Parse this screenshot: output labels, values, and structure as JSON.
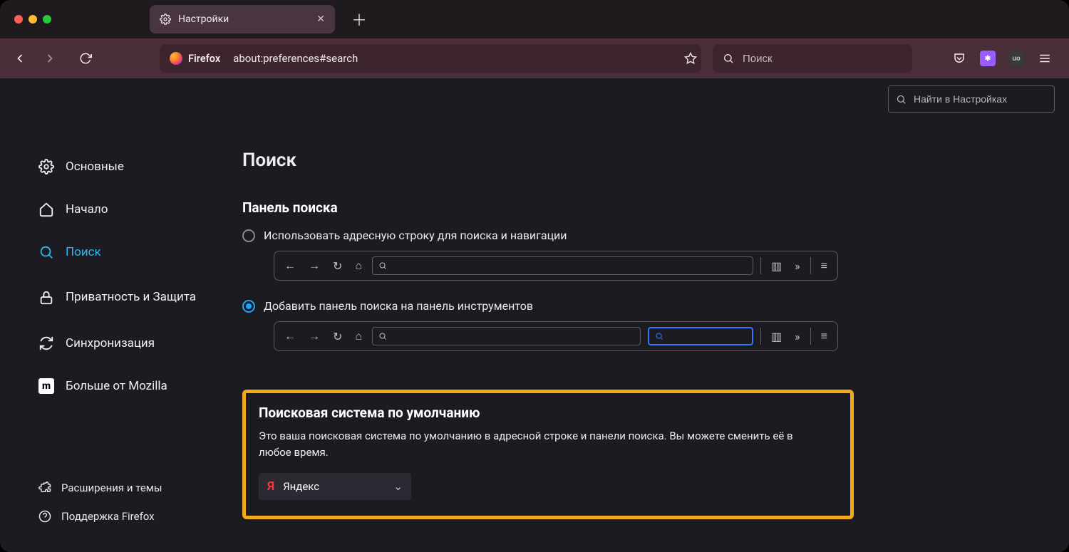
{
  "tab": {
    "title": "Настройки"
  },
  "urlbar": {
    "identity_label": "Firefox",
    "url": "about:preferences#search"
  },
  "toolbar_search": {
    "placeholder": "Поиск"
  },
  "settings_search": {
    "placeholder": "Найти в Настройках"
  },
  "sidebar": {
    "items": [
      {
        "label": "Основные"
      },
      {
        "label": "Начало"
      },
      {
        "label": "Поиск"
      },
      {
        "label": "Приватность и Защита"
      },
      {
        "label": "Синхронизация"
      },
      {
        "label": "Больше от Mozilla"
      }
    ],
    "footer": {
      "extensions_label": "Расширения и темы",
      "support_label": "Поддержка Firefox"
    }
  },
  "main": {
    "page_title": "Поиск",
    "search_bar_section": {
      "heading": "Панель поиска",
      "option_url_bar": "Использовать адресную строку для поиска и навигации",
      "option_add_searchbar": "Добавить панель поиска на панель инструментов",
      "selected": "add_searchbar"
    },
    "default_engine_section": {
      "heading": "Поисковая система по умолчанию",
      "description": "Это ваша поисковая система по умолчанию в адресной строке и панели поиска. Вы можете сменить её в любое время.",
      "selected_engine": "Яндекс"
    }
  }
}
